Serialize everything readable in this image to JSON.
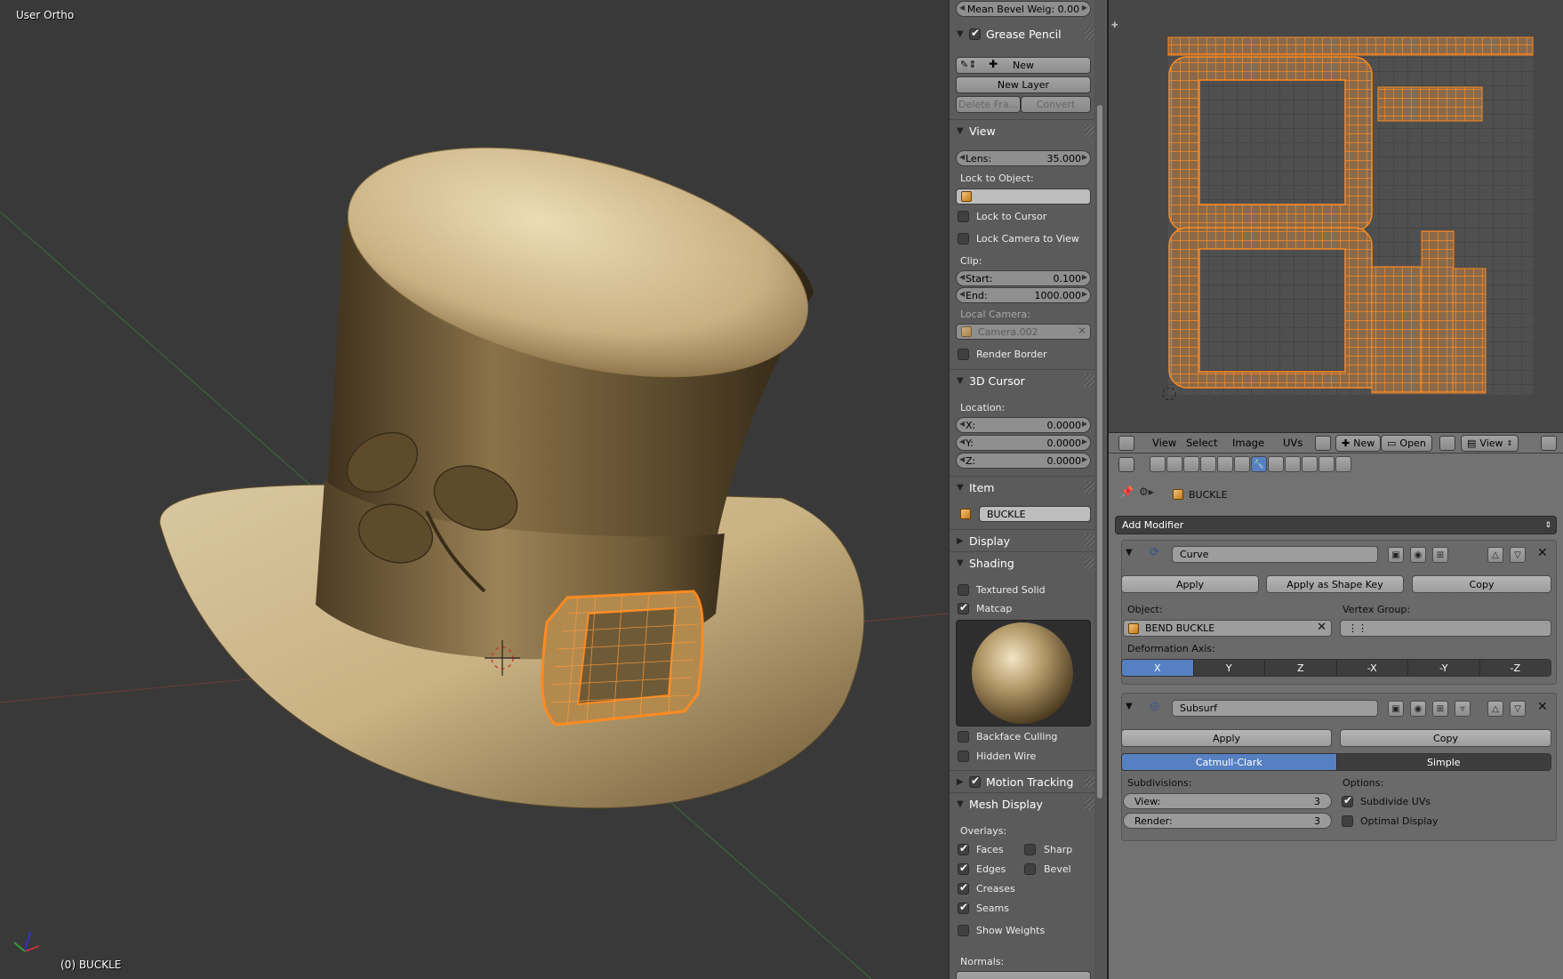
{
  "viewport": {
    "view_name": "User Ortho",
    "object_info": "(0) BUCKLE"
  },
  "npanel": {
    "mean_bevel": "Mean Bevel Weig: 0.00",
    "grease_pencil": {
      "title": "Grease Pencil",
      "new_label": "New",
      "new_layer": "New Layer",
      "delete_frame": "Delete Fra...",
      "convert": "Convert"
    },
    "view": {
      "title": "View",
      "lens_label": "Lens:",
      "lens_value": "35.000",
      "lock_to_object": "Lock to Object:",
      "lock_to_cursor": "Lock to Cursor",
      "lock_camera": "Lock Camera to View",
      "clip": "Clip:",
      "start_label": "Start:",
      "start_value": "0.100",
      "end_label": "End:",
      "end_value": "1000.000",
      "local_camera": "Local Camera:",
      "camera_name": "Camera.002",
      "render_border": "Render Border"
    },
    "cursor": {
      "title": "3D Cursor",
      "location": "Location:",
      "x_label": "X:",
      "x_value": "0.0000",
      "y_label": "Y:",
      "y_value": "0.0000",
      "z_label": "Z:",
      "z_value": "0.0000"
    },
    "item": {
      "title": "Item",
      "name": "BUCKLE"
    },
    "display": {
      "title": "Display"
    },
    "shading": {
      "title": "Shading",
      "textured_solid": "Textured Solid",
      "matcap": "Matcap",
      "backface": "Backface Culling",
      "hidden_wire": "Hidden Wire"
    },
    "motion_tracking": {
      "title": "Motion Tracking"
    },
    "mesh_display": {
      "title": "Mesh Display",
      "overlays": "Overlays:",
      "faces": "Faces",
      "sharp": "Sharp",
      "edges": "Edges",
      "bevel": "Bevel",
      "creases": "Creases",
      "seams": "Seams",
      "show_weights": "Show Weights",
      "normals": "Normals:"
    }
  },
  "uv_header": {
    "menu_view": "View",
    "menu_select": "Select",
    "menu_image": "Image",
    "menu_uvs": "UVs",
    "new": "New",
    "open": "Open",
    "view": "View"
  },
  "properties": {
    "object_name": "BUCKLE",
    "add_modifier": "Add Modifier",
    "curve_mod": {
      "name": "Curve",
      "apply": "Apply",
      "apply_shape": "Apply as Shape Key",
      "copy": "Copy",
      "object_label": "Object:",
      "object_value": "BEND BUCKLE",
      "vgroup_label": "Vertex Group:",
      "deform_label": "Deformation Axis:",
      "axes": [
        "X",
        "Y",
        "Z",
        "-X",
        "-Y",
        "-Z"
      ]
    },
    "subsurf_mod": {
      "name": "Subsurf",
      "apply": "Apply",
      "copy": "Copy",
      "catmull": "Catmull-Clark",
      "simple": "Simple",
      "subdivisions": "Subdivisions:",
      "options": "Options:",
      "view_label": "View:",
      "view_value": "3",
      "render_label": "Render:",
      "render_value": "3",
      "subdivide_uvs": "Subdivide UVs",
      "optimal": "Optimal Display"
    }
  },
  "colors": {
    "accent": "#5680c2",
    "selection": "#ff8a20",
    "hat": "#b59766"
  }
}
